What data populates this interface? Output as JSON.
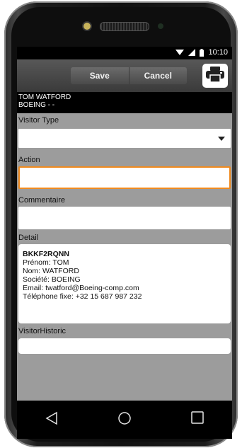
{
  "statusbar": {
    "time": "10:10"
  },
  "actionbar": {
    "save_label": "Save",
    "cancel_label": "Cancel"
  },
  "visitor": {
    "name": "TOM WATFORD",
    "company_line": "BOEING - -"
  },
  "form": {
    "visitor_type_label": "Visitor Type",
    "visitor_type_value": "",
    "action_label": "Action",
    "action_value": "",
    "comment_label": "Commentaire",
    "comment_value": "",
    "detail_label": "Detail",
    "detail": {
      "code": "BKKF2RQNN",
      "prenom": "Prénom: TOM",
      "nom": "Nom: WATFORD",
      "societe": "Société: BOEING",
      "email": "Email: twatford@Boeing-comp.com",
      "telephone": "Téléphone fixe: +32 15 687 987 232"
    },
    "historic_label": "VisitorHistoric",
    "historic_value": ""
  },
  "colors": {
    "focus_border": "#f08a1e",
    "header_bg": "#000000",
    "screen_bg": "#9c9c9c"
  },
  "icons": [
    "wifi-icon",
    "signal-icon",
    "battery-icon",
    "print-icon",
    "back-icon",
    "home-icon",
    "recents-icon",
    "chevron-down-icon"
  ]
}
